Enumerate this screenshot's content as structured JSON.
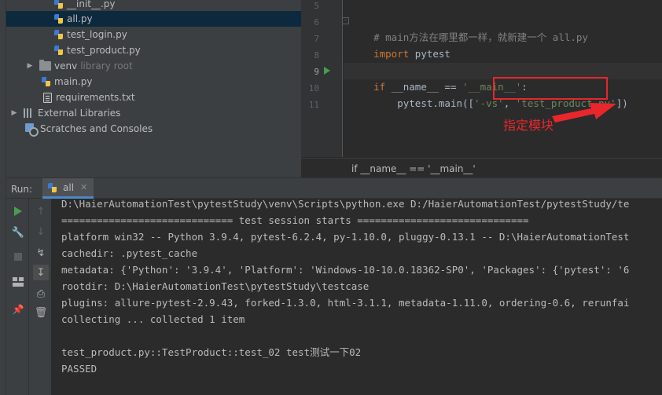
{
  "project_tree": {
    "items": [
      {
        "label": "__init__.py",
        "kind": "py"
      },
      {
        "label": "all.py",
        "kind": "py",
        "selected": true
      },
      {
        "label": "test_login.py",
        "kind": "py"
      },
      {
        "label": "test_product.py",
        "kind": "py"
      },
      {
        "label": "venv",
        "kind": "folder",
        "suffix": "library root"
      },
      {
        "label": "main.py",
        "kind": "py"
      },
      {
        "label": "requirements.txt",
        "kind": "txt"
      },
      {
        "label": "External Libraries",
        "kind": "lib"
      },
      {
        "label": "Scratches and Consoles",
        "kind": "scratch"
      }
    ]
  },
  "editor": {
    "line_numbers": [
      "5",
      "6",
      "7",
      "8",
      "9",
      "10",
      "11"
    ],
    "lines": {
      "l6_comment": "# main方法在哪里都一样，就新建一个 all.py",
      "l7_kw": "import",
      "l7_mod": " pytest",
      "l9_kw": "if",
      "l9_name": " __name__ == ",
      "l9_str": "'__main__'",
      "l9_colon": ":",
      "l10_call": "    pytest.main([",
      "l10_arg1": "'-vs'",
      "l10_comma": ", ",
      "l10_arg2": "'test_product.py'",
      "l10_end": "])"
    },
    "annotation": "指定模块",
    "breadcrumb": "if __name__ == '__main__'"
  },
  "run_panel": {
    "label": "Run:",
    "tab": "all",
    "console_lines": [
      "D:\\HaierAutomationTest\\pytestStudy\\venv\\Scripts\\python.exe D:/HaierAutomationTest/pytestStudy/te",
      "============================= test session starts =============================",
      "platform win32 -- Python 3.9.4, pytest-6.2.4, py-1.10.0, pluggy-0.13.1 -- D:\\HaierAutomationTest",
      "cachedir: .pytest_cache",
      "metadata: {'Python': '3.9.4', 'Platform': 'Windows-10-10.0.18362-SP0', 'Packages': {'pytest': '6",
      "rootdir: D:\\HaierAutomationTest\\pytestStudy\\testcase",
      "plugins: allure-pytest-2.9.43, forked-1.3.0, html-3.1.1, metadata-1.11.0, ordering-0.6, rerunfai",
      "collecting ... collected 1 item",
      "",
      "test_product.py::TestProduct::test_02 test测试一下02",
      "PASSED"
    ]
  },
  "colors": {
    "accent_red": "#e8262c",
    "run_green": "#499c54",
    "keyword": "#cc7832",
    "string": "#6a8759"
  }
}
